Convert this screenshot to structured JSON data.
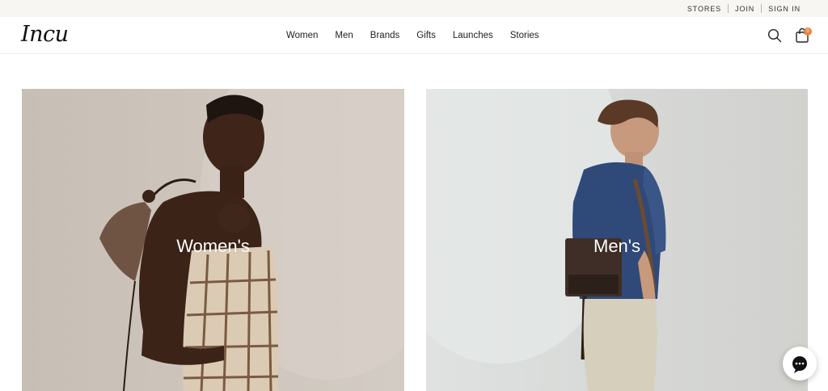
{
  "utility": {
    "stores": "STORES",
    "join": "JOIN",
    "sign_in": "SIGN IN"
  },
  "header": {
    "logo": "Incu",
    "nav": [
      "Women",
      "Men",
      "Brands",
      "Gifts",
      "Launches",
      "Stories"
    ],
    "cart_count": "0"
  },
  "tiles": {
    "women": {
      "label": "Women's"
    },
    "men": {
      "label": "Men's"
    }
  },
  "icons": {
    "search": "search-icon",
    "cart": "shopping-bag-icon",
    "chat": "chat-icon"
  },
  "colors": {
    "cart_badge": "#e8833a",
    "utility_bar_bg": "#f8f6f2"
  }
}
